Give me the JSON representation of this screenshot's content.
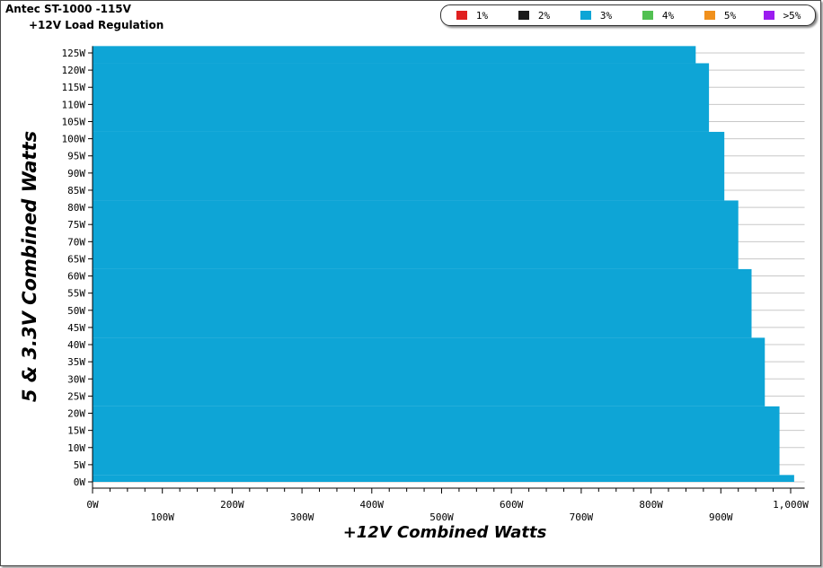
{
  "title": "Antec ST-1000 -115V",
  "subtitle": "+12V Load Regulation",
  "legend": [
    {
      "label": "1%",
      "color": "#e02020"
    },
    {
      "label": "2%",
      "color": "#1a1a1a"
    },
    {
      "label": "3%",
      "color": "#0ea5d6"
    },
    {
      "label": "4%",
      "color": "#52c052"
    },
    {
      "label": "5%",
      "color": "#f0901c"
    },
    {
      "label": ">5%",
      "color": "#9b1cf0"
    }
  ],
  "chart_data": {
    "type": "area",
    "title": "Antec ST-1000 -115V",
    "subtitle": "+12V Load Regulation",
    "xlabel": "+12V Combined Watts",
    "ylabel": "5 & 3.3V Combined Watts",
    "xlim": [
      0,
      1000
    ],
    "ylim": [
      0,
      125
    ],
    "x_ticks": [
      "0W",
      "100W",
      "200W",
      "300W",
      "400W",
      "500W",
      "600W",
      "700W",
      "800W",
      "900W",
      "1,000W"
    ],
    "y_ticks": [
      "0W",
      "5W",
      "10W",
      "15W",
      "20W",
      "25W",
      "30W",
      "35W",
      "40W",
      "45W",
      "50W",
      "55W",
      "60W",
      "65W",
      "70W",
      "75W",
      "80W",
      "85W",
      "90W",
      "95W",
      "100W",
      "105W",
      "110W",
      "115W",
      "120W",
      "125W"
    ],
    "grid": true,
    "legend_position": "top-right",
    "series": [
      {
        "name": "3%",
        "color": "#0ea5d6",
        "boundary": [
          {
            "y_min": 0,
            "y_max": 2,
            "x_max": 1005
          },
          {
            "y_min": 2,
            "y_max": 22,
            "x_max": 984
          },
          {
            "y_min": 22,
            "y_max": 42,
            "x_max": 963
          },
          {
            "y_min": 42,
            "y_max": 62,
            "x_max": 944
          },
          {
            "y_min": 62,
            "y_max": 82,
            "x_max": 925
          },
          {
            "y_min": 82,
            "y_max": 102,
            "x_max": 905
          },
          {
            "y_min": 102,
            "y_max": 122,
            "x_max": 883
          },
          {
            "y_min": 122,
            "y_max": 127,
            "x_max": 864
          }
        ]
      }
    ]
  }
}
